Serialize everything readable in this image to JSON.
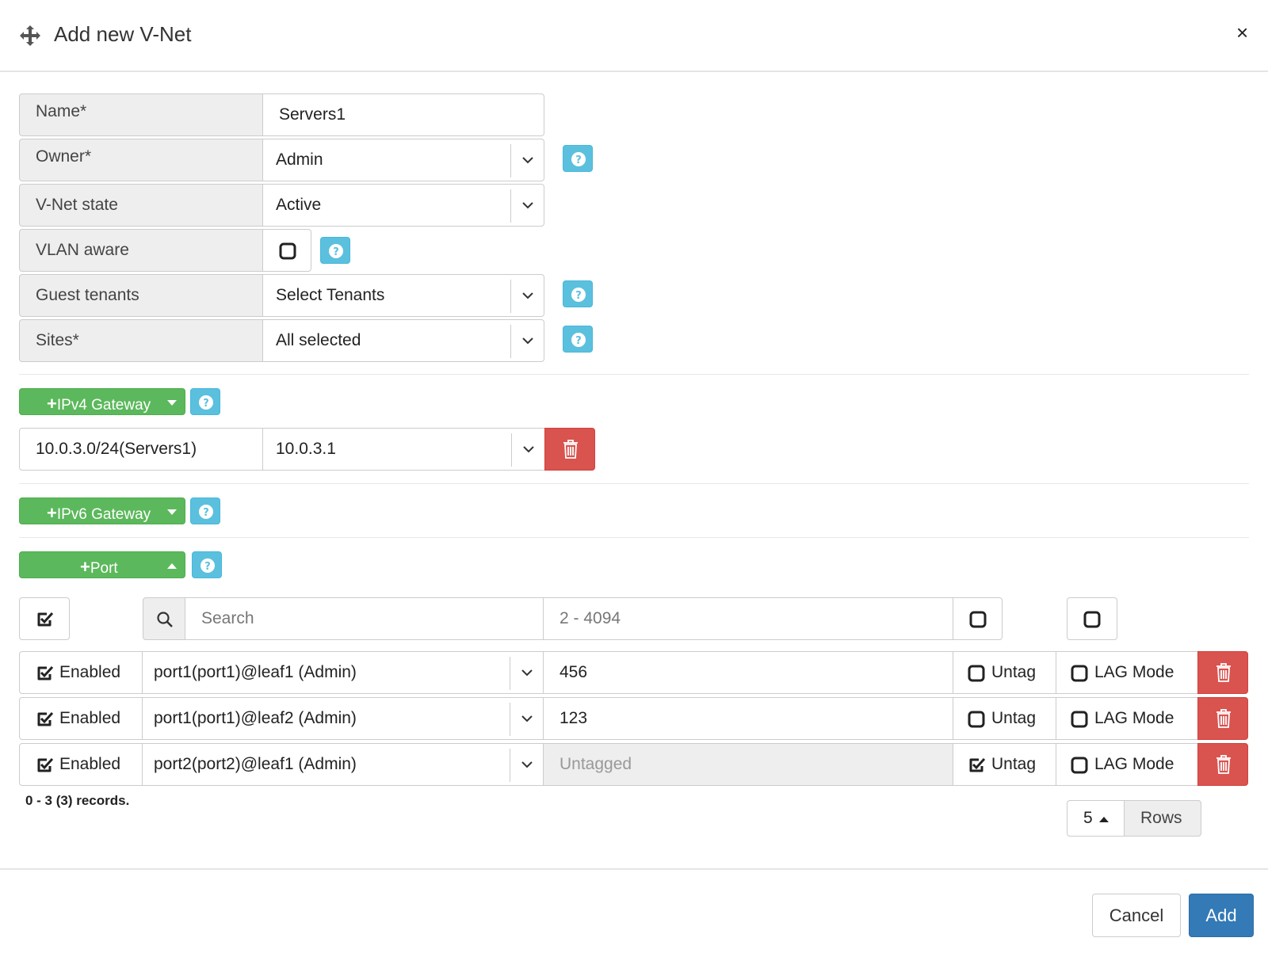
{
  "dialog": {
    "title": "Add new V-Net",
    "close_symbol": "×",
    "icons": {
      "move": "move-arrows-icon",
      "close": "close-icon"
    }
  },
  "form": {
    "name": {
      "label": "Name*",
      "value": "Servers1"
    },
    "owner": {
      "label": "Owner*",
      "value": "Admin"
    },
    "vnet_state": {
      "label": "V-Net state",
      "value": "Active"
    },
    "vlan_aware": {
      "label": "VLAN aware",
      "checked": false
    },
    "guest_tenants": {
      "label": "Guest tenants",
      "value": "Select Tenants"
    },
    "sites": {
      "label": "Sites*",
      "value": "All selected"
    }
  },
  "ipv4": {
    "button_label": "IPv4 Gateway",
    "rows": [
      {
        "subnet": "10.0.3.0/24(Servers1)",
        "gateway": "10.0.3.1"
      }
    ]
  },
  "ipv6": {
    "button_label": "IPv6 Gateway"
  },
  "ports": {
    "button_label": "Port",
    "filter": {
      "search_placeholder": "Search",
      "vlan_placeholder": "2 - 4094"
    },
    "rows": [
      {
        "enabled_label": "Enabled",
        "port": "port1(port1)@leaf1 (Admin)",
        "vlan": "456",
        "untag_label": "Untag",
        "untag_checked": false,
        "lag_label": "LAG Mode",
        "lag_checked": false
      },
      {
        "enabled_label": "Enabled",
        "port": "port1(port1)@leaf2 (Admin)",
        "vlan": "123",
        "untag_label": "Untag",
        "untag_checked": false,
        "lag_label": "LAG Mode",
        "lag_checked": false
      },
      {
        "enabled_label": "Enabled",
        "port": "port2(port2)@leaf1 (Admin)",
        "vlan_placeholder": "Untagged",
        "untag_label": "Untag",
        "untag_checked": true,
        "lag_label": "LAG Mode",
        "lag_checked": false
      }
    ],
    "records_text": "0 - 3 (3) records.",
    "page_size": "5",
    "rows_label": "Rows"
  },
  "footer": {
    "cancel_label": "Cancel",
    "add_label": "Add"
  },
  "colors": {
    "help": "#5bc0de",
    "success": "#5cb85c",
    "danger": "#d9534f",
    "primary": "#337ab7",
    "label_bg": "#eeeeee"
  }
}
